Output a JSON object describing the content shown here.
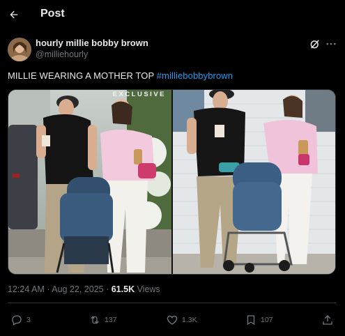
{
  "header": {
    "title": "Post"
  },
  "author": {
    "display_name": "hourly millie bobby brown",
    "handle": "@milliehourly"
  },
  "tweet": {
    "text": "MILLIE WEARING A MOTHER TOP ",
    "hashtag": "#milliebobbybrown"
  },
  "media": {
    "watermark": "EXCLUSIVE"
  },
  "meta": {
    "time": "12:24 AM",
    "separator": " · ",
    "date": "Aug 22, 2025",
    "views_count": "61.5K",
    "views_label": " Views"
  },
  "actions": {
    "replies": "3",
    "reposts": "137",
    "likes": "1.3K",
    "bookmarks": "107"
  },
  "icons": {
    "back": "arrow-left-icon",
    "grok": "grok-icon",
    "more": "more-horizontal-icon",
    "reply": "reply-icon",
    "repost": "repost-icon",
    "like": "heart-icon",
    "bookmark": "bookmark-icon",
    "share": "share-icon"
  },
  "colors": {
    "background": "#000000",
    "text": "#e7e9ea",
    "secondary": "#71767b",
    "link": "#1d9bf0",
    "border": "#2f3336"
  }
}
